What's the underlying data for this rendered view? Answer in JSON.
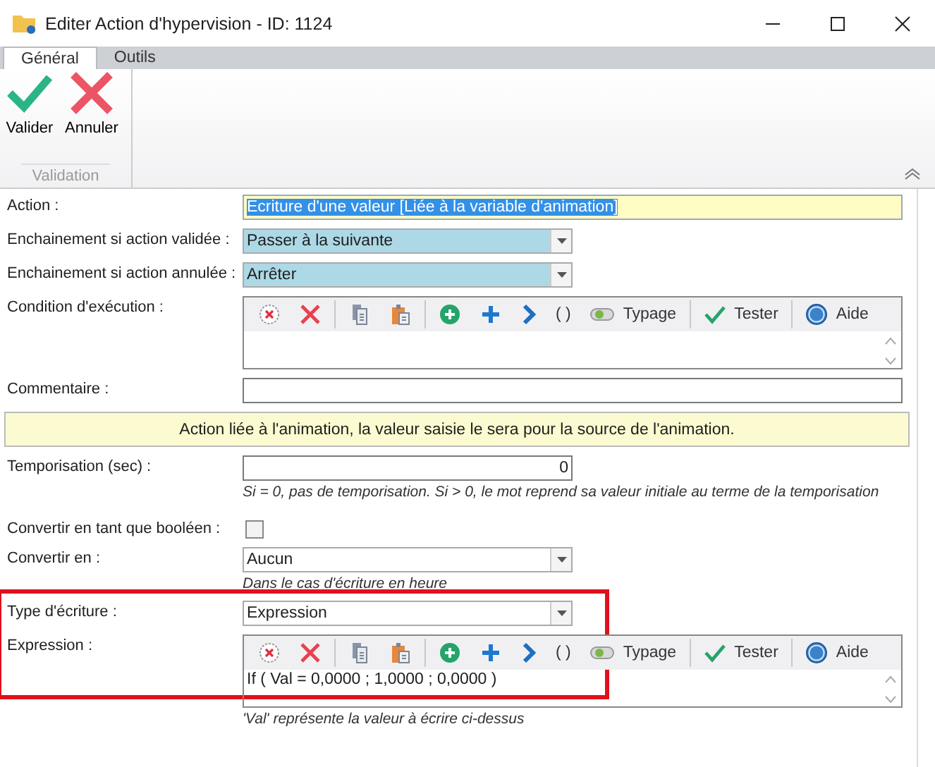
{
  "window": {
    "title": "Editer Action d'hypervision - ID: 1124"
  },
  "tabs": [
    {
      "label": "Général",
      "selected": true
    },
    {
      "label": "Outils",
      "selected": false
    }
  ],
  "ribbon": {
    "group": "Validation",
    "buttons": [
      {
        "kind": "validate",
        "label": "Valider"
      },
      {
        "kind": "cancel",
        "label": "Annuler"
      }
    ]
  },
  "form": [
    {
      "kind": "text",
      "label": "Action :",
      "value": "Ecriture d'une valeur [Liée à la variable d'animation]",
      "selected": true
    },
    {
      "kind": "combo",
      "label": "Enchainement si action validée :",
      "value": "Passer à la suivante",
      "filled": true
    },
    {
      "kind": "combo",
      "label": "Enchainement si action annulée :",
      "value": "Arrêter",
      "filled": true
    },
    {
      "kind": "editor",
      "label": "Condition d'exécution :",
      "toolbar": [
        {
          "kind": "clear"
        },
        {
          "kind": "delete"
        },
        {
          "kind": "sep"
        },
        {
          "kind": "copy"
        },
        {
          "kind": "paste"
        },
        {
          "kind": "sep"
        },
        {
          "kind": "add"
        },
        {
          "kind": "plus"
        },
        {
          "kind": "next"
        },
        {
          "kind": "parens",
          "label": "( )"
        },
        {
          "kind": "typage",
          "label": "Typage"
        },
        {
          "kind": "sep"
        },
        {
          "kind": "tester",
          "label": "Tester"
        },
        {
          "kind": "sep"
        },
        {
          "kind": "aide",
          "label": "Aide"
        }
      ]
    },
    {
      "kind": "input",
      "label": "Commentaire :"
    },
    {
      "kind": "info",
      "value": "Action liée à l'animation, la valeur saisie le sera pour la source de l'animation."
    },
    {
      "kind": "number",
      "label": "Temporisation (sec) :",
      "value": "0",
      "hint": "Si = 0, pas de temporisation. Si > 0, le mot reprend sa valeur initiale au terme de la temporisation"
    },
    {
      "kind": "checkbox",
      "label": "Convertir en tant que booléen :",
      "checked": false
    },
    {
      "kind": "combo",
      "label": "Convertir en :",
      "value": "Aucun",
      "filled": false,
      "hint": "Dans le cas d'écriture en heure"
    },
    {
      "kind": "combo",
      "label": "Type d'écriture :",
      "value": "Expression",
      "filled": false,
      "framed": true
    },
    {
      "kind": "editor",
      "label": "Expression :",
      "value": "If  (  Val  =  0,0000  ;  1,0000  ;  0,0000  )",
      "hint": "'Val' représente la valeur à écrire ci-dessus",
      "toolbar": [
        {
          "kind": "clear"
        },
        {
          "kind": "delete"
        },
        {
          "kind": "sep"
        },
        {
          "kind": "copy"
        },
        {
          "kind": "paste"
        },
        {
          "kind": "sep"
        },
        {
          "kind": "add"
        },
        {
          "kind": "plus"
        },
        {
          "kind": "next"
        },
        {
          "kind": "parens",
          "label": "( )"
        },
        {
          "kind": "typage",
          "label": "Typage"
        },
        {
          "kind": "sep"
        },
        {
          "kind": "tester",
          "label": "Tester"
        },
        {
          "kind": "sep"
        },
        {
          "kind": "aide",
          "label": "Aide"
        }
      ]
    }
  ]
}
